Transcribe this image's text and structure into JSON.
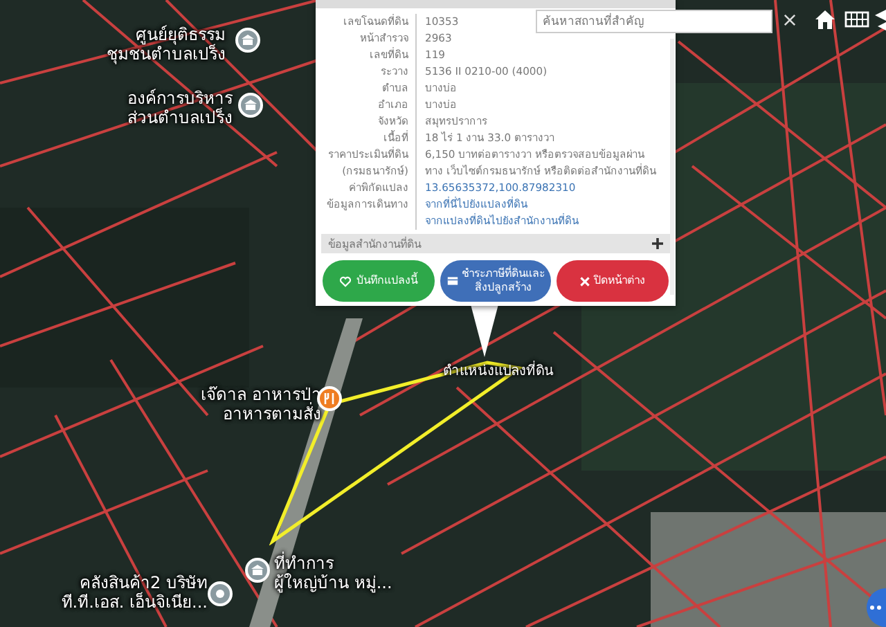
{
  "map": {
    "places": [
      {
        "lines": [
          "ศูนย์ยุติธรรม",
          "ชุมชนตำบลเปร็ง"
        ],
        "kind": "office"
      },
      {
        "lines": [
          "องค์การบริหาร",
          "ส่วนตำบลเปร็ง"
        ],
        "kind": "office"
      },
      {
        "lines": [
          "เจ๊ดาล อาหารป่า",
          "อาหารตามสั่ง"
        ],
        "kind": "restaurant"
      },
      {
        "lines": [
          "ตำแหน่งแปลงที่ดิน"
        ],
        "kind": "parcel"
      },
      {
        "lines": [
          "ที่ทำการ",
          "ผู้ใหญ่บ้าน หมู่..."
        ],
        "kind": "office"
      },
      {
        "lines": [
          "คลังสินค้า2 บริษัท",
          "ที.ที.เอส. เอ็นจิเนีย..."
        ],
        "kind": "place"
      }
    ]
  },
  "search": {
    "placeholder": "ค้นหาสถานที่สำคัญ"
  },
  "popup": {
    "fields": [
      {
        "label": [
          "เลขโฉนดที่ดิน"
        ],
        "values": [
          "10353"
        ],
        "kind": "text"
      },
      {
        "label": [
          "หน้าสำรวจ"
        ],
        "values": [
          "2963"
        ],
        "kind": "text"
      },
      {
        "label": [
          "เลขที่ดิน"
        ],
        "values": [
          "119"
        ],
        "kind": "text"
      },
      {
        "label": [
          "ระวาง"
        ],
        "values": [
          "5136 II 0210-00 (4000)"
        ],
        "kind": "text"
      },
      {
        "label": [
          "ตำบล"
        ],
        "values": [
          "บางบ่อ"
        ],
        "kind": "text"
      },
      {
        "label": [
          "อำเภอ"
        ],
        "values": [
          "บางบ่อ"
        ],
        "kind": "text"
      },
      {
        "label": [
          "จังหวัด"
        ],
        "values": [
          "สมุทรปราการ"
        ],
        "kind": "text"
      },
      {
        "label": [
          "เนื้อที่"
        ],
        "values": [
          "18 ไร่ 1 งาน 33.0 ตารางวา"
        ],
        "kind": "text"
      },
      {
        "label": [
          "ราคาประเมินที่ดิน",
          "(กรมธนารักษ์)"
        ],
        "values": [
          "6,150 บาทต่อตารางวา หรือตรวจสอบข้อมูลผ่าน",
          "ทาง เว็บไซต์กรมธนารักษ์ หรือติดต่อสำนักงานที่ดิน"
        ],
        "kind": "text"
      },
      {
        "label": [
          "ค่าพิกัดแปลง"
        ],
        "values": [
          "13.65635372,100.87982310"
        ],
        "kind": "link"
      },
      {
        "label": [
          "ข้อมูลการเดินทาง"
        ],
        "values": [
          "จากที่นี่ไปยังแปลงที่ดิน",
          "จากแปลงที่ดินไปยังสำนักงานที่ดิน"
        ],
        "kind": "link"
      }
    ],
    "section": {
      "title": "ข้อมูลสำนักงานที่ดิน",
      "expanded": false
    },
    "buttons": [
      {
        "lines": [
          "บันทึกแปลงนี้"
        ],
        "kind": "save"
      },
      {
        "lines": [
          "ชำระภาษีที่ดินและ",
          "สิ่งปลูกสร้าง"
        ],
        "kind": "tax"
      },
      {
        "lines": [
          "ปิดหน้าต่าง"
        ],
        "kind": "close"
      }
    ]
  }
}
